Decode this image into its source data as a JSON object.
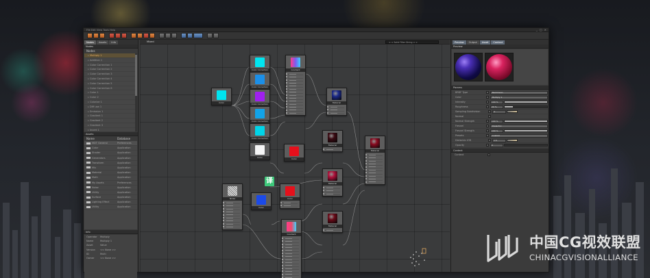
{
  "window": {
    "title_menu": "File  Edit  View  Tools  Help",
    "controls": [
      "_",
      "□",
      "×"
    ]
  },
  "left_panel": {
    "tabs": [
      "Nodes",
      "Assets",
      "Info"
    ],
    "nodes_header": "Nodes",
    "nodes_subheader": "Nodes",
    "nodes": [
      "Multiply 1",
      "Addition 1",
      "Color Correction 1",
      "Color Correction 2",
      "Color Correction 3",
      "Color Correction 4",
      "Color Correction 5",
      "Color Correction 6",
      "Color 1",
      "Color 2",
      "Colorize 1",
      "Diff use 1",
      "Emission 1",
      "Gradient 1",
      "Gradient 2",
      "Gradient 3",
      "Invert 1"
    ],
    "assets_header": "Assets",
    "assets_columns": [
      "Name",
      "Database"
    ],
    "assets": [
      {
        "name": "MDT General",
        "db": "Preferences"
      },
      {
        "name": "Color",
        "db": "Application"
      },
      {
        "name": "Shader",
        "db": "Application"
      },
      {
        "name": "Generators",
        "db": "Application"
      },
      {
        "name": "Transform",
        "db": "Application"
      },
      {
        "name": "Mix",
        "db": "Application"
      },
      {
        "name": "Material",
        "db": "Application"
      },
      {
        "name": "Math",
        "db": "Application"
      },
      {
        "name": "My Assets",
        "db": "Preferences"
      },
      {
        "name": "Noise",
        "db": "Application"
      },
      {
        "name": "Utility",
        "db": "Application"
      },
      {
        "name": "Surface",
        "db": "Application"
      },
      {
        "name": "Lighting Effect",
        "db": "Application"
      },
      {
        "name": "Utility",
        "db": "Application"
      }
    ],
    "info_header": "Info",
    "info": [
      {
        "k": "Operator",
        "v": "Multiply"
      },
      {
        "k": "Name",
        "v": "Multiply 1"
      },
      {
        "k": "Asset",
        "v": "Value"
      },
      {
        "k": "Version",
        "v": "<< None >>"
      },
      {
        "k": "ID",
        "v": "Multi"
      },
      {
        "k": "Owner",
        "v": "<< None >>"
      }
    ]
  },
  "graph": {
    "title": "Mixed",
    "search_placeholder": "< < Solid Filter String > >",
    "nodes": [
      {
        "label": "Color",
        "preview": "#00e5f0"
      },
      {
        "label": "Color Correction",
        "preview": "#00e5f0"
      },
      {
        "label": "Color Correction",
        "preview": "#1b8fe8"
      },
      {
        "label": "Color Correction",
        "preview": "#a020f0"
      },
      {
        "label": "Color Correction",
        "preview": "#12a3e8"
      },
      {
        "label": "Color Correction",
        "preview": "#00d4e8"
      },
      {
        "label": "Gradient",
        "preview": "#7a5cf0"
      },
      {
        "label": "Material",
        "preview": "#1b2a8a"
      },
      {
        "label": "Color",
        "preview": "#f4f4f4"
      },
      {
        "label": "Color",
        "preview": "#e5101b"
      },
      {
        "label": "Material",
        "preview": "#3a0a12"
      },
      {
        "label": "Material",
        "preview": "#b0103a"
      },
      {
        "label": "Noise",
        "preview": "#c8c8c8"
      },
      {
        "label": "Color",
        "preview": "#1b4ae8"
      },
      {
        "label": "Color",
        "preview": "#e5101b"
      },
      {
        "label": "Material",
        "preview": "#6a0a18"
      },
      {
        "label": "Material",
        "preview": "#8a0a20"
      },
      {
        "label": "Gradient",
        "preview": "#f04a6a"
      }
    ],
    "badge_glyph": "译"
  },
  "right_panel": {
    "tabs": [
      "Preview",
      "Output",
      "Asset",
      "Context"
    ],
    "preview_header": "Preview",
    "params_header": "Params",
    "params": [
      {
        "label": "BRDF Type",
        "dropdown": "Beckmann"
      },
      {
        "label": "Color",
        "dropdown": "Multiply 1"
      },
      {
        "label": "Intensity",
        "value": "100 %",
        "fill": 1.0
      },
      {
        "label": "Roughness",
        "value": "20 %",
        "fill": 0.2
      },
      {
        "label": "Sampling Subdivision",
        "value": "4",
        "fill": 0.15
      },
      {
        "label": "Normal",
        "value": ""
      },
      {
        "label": "Normal Strength",
        "value": "100 %",
        "fill": 1.0
      },
      {
        "label": "Fresnel",
        "dropdown": "Dielectric"
      },
      {
        "label": "Fresnel Strength",
        "value": "100 %",
        "fill": 1.0
      },
      {
        "label": "Presets",
        "dropdown": "Custom"
      },
      {
        "label": "Dielectric IOR",
        "value": "1.5",
        "fill": 0.15
      },
      {
        "label": "Opacity",
        "value": "0",
        "fill": 0.0
      }
    ],
    "context_header": "Context",
    "context_item": "Context"
  },
  "watermark": {
    "cn": "中国CG视效联盟",
    "en": "CHINACGVISIONALLIANCE"
  },
  "colors": {
    "accent_orange": "#e0a85e",
    "badge_green": "#3dc87a"
  }
}
